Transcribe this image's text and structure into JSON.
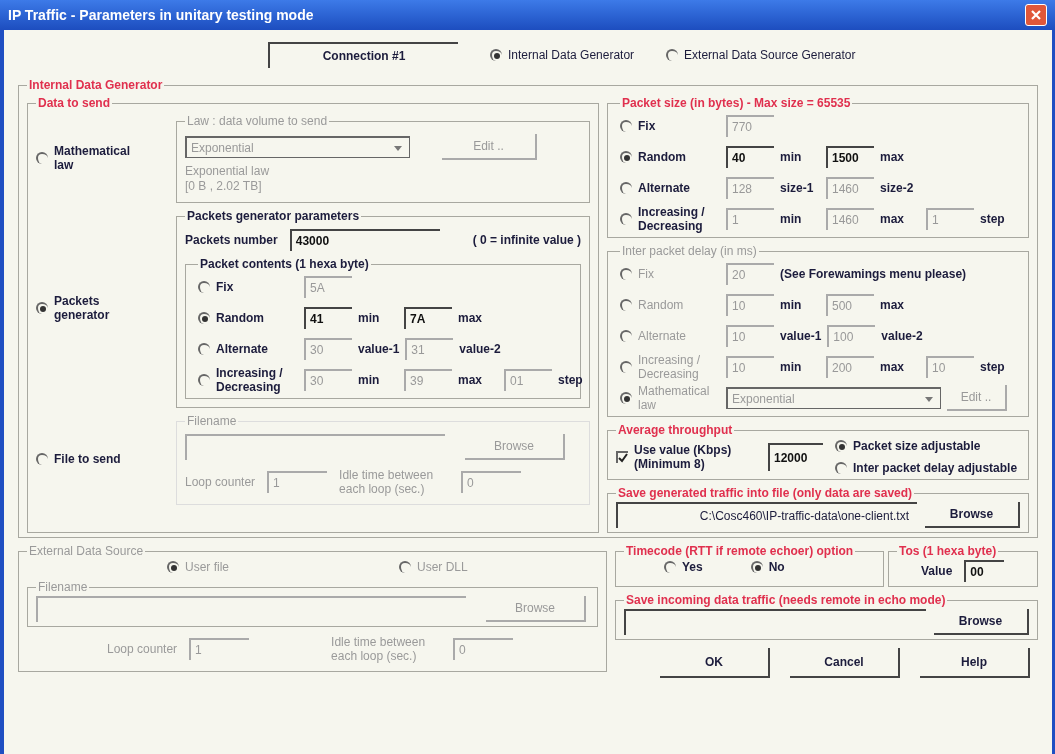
{
  "window": {
    "title": "IP Traffic - Parameters in unitary testing mode"
  },
  "connection": {
    "label": "Connection #1"
  },
  "source_options": [
    {
      "label": "Internal Data Generator",
      "selected": true
    },
    {
      "label": "External Data Source Generator",
      "selected": false
    }
  ],
  "internal": {
    "title": "Internal Data Generator",
    "data_to_send": {
      "title": "Data to send",
      "modes": [
        {
          "label": "Mathematical law",
          "selected": false
        },
        {
          "label": "Packets generator",
          "selected": true
        },
        {
          "label": "File to send",
          "selected": false
        }
      ]
    },
    "law": {
      "title": "Law : data volume to send",
      "disabled": true,
      "dropdown": "Exponential",
      "edit": "Edit ..",
      "description": [
        "Exponential law",
        "[0 B , 2.02 TB]"
      ]
    },
    "packets": {
      "title": "Packets generator parameters",
      "number_label": "Packets number",
      "number": "43000",
      "hint": "( 0 = infinite value )",
      "contents": {
        "title": "Packet contents (1 hexa byte)",
        "disabled": false,
        "rows": [
          {
            "label": "Fix",
            "selected": false,
            "cells": [
              {
                "kind": "field",
                "value": "5A",
                "disabled": true
              }
            ]
          },
          {
            "label": "Random",
            "selected": true,
            "cells": [
              {
                "kind": "field",
                "value": "41",
                "disabled": false
              },
              {
                "kind": "unit",
                "text": "min"
              },
              {
                "kind": "field",
                "value": "7A",
                "disabled": false
              },
              {
                "kind": "unit",
                "text": "max"
              }
            ]
          },
          {
            "label": "Alternate",
            "selected": false,
            "cells": [
              {
                "kind": "field",
                "value": "30",
                "disabled": true
              },
              {
                "kind": "unit",
                "text": "value-1"
              },
              {
                "kind": "field",
                "value": "31",
                "disabled": true
              },
              {
                "kind": "unit",
                "text": "value-2"
              }
            ]
          },
          {
            "label": "Increasing / Decreasing",
            "selected": false,
            "cells": [
              {
                "kind": "field",
                "value": "30",
                "disabled": true
              },
              {
                "kind": "unit",
                "text": "min"
              },
              {
                "kind": "field",
                "value": "39",
                "disabled": true
              },
              {
                "kind": "unit",
                "text": "max"
              },
              {
                "kind": "field",
                "value": "01",
                "disabled": true
              },
              {
                "kind": "unit",
                "text": "step"
              }
            ]
          }
        ]
      }
    },
    "file": {
      "title": "Filename",
      "disabled": true,
      "browse": "Browse",
      "loop_label": "Loop counter",
      "loop": "1",
      "idle_label": "Idle time between each loop (sec.)",
      "idle": "0"
    }
  },
  "packet_size": {
    "title": "Packet size (in bytes) - Max size = 65535",
    "disabled": false,
    "rows": [
      {
        "label": "Fix",
        "selected": false,
        "cells": [
          {
            "kind": "field",
            "value": "770",
            "disabled": true
          }
        ]
      },
      {
        "label": "Random",
        "selected": true,
        "cells": [
          {
            "kind": "field",
            "value": "40",
            "disabled": false
          },
          {
            "kind": "unit",
            "text": "min"
          },
          {
            "kind": "field",
            "value": "1500",
            "disabled": false
          },
          {
            "kind": "unit",
            "text": "max"
          }
        ]
      },
      {
        "label": "Alternate",
        "selected": false,
        "cells": [
          {
            "kind": "field",
            "value": "128",
            "disabled": true
          },
          {
            "kind": "unit",
            "text": "size-1"
          },
          {
            "kind": "field",
            "value": "1460",
            "disabled": true
          },
          {
            "kind": "unit",
            "text": "size-2"
          }
        ]
      },
      {
        "label": "Increasing / Decreasing",
        "selected": false,
        "cells": [
          {
            "kind": "field",
            "value": "1",
            "disabled": true
          },
          {
            "kind": "unit",
            "text": "min"
          },
          {
            "kind": "field",
            "value": "1460",
            "disabled": true
          },
          {
            "kind": "unit",
            "text": "max"
          },
          {
            "kind": "field",
            "value": "1",
            "disabled": true
          },
          {
            "kind": "unit",
            "text": "step"
          }
        ]
      }
    ]
  },
  "delay": {
    "title": "Inter packet delay (in ms)",
    "disabled": true,
    "rows": [
      {
        "label": "Fix",
        "selected": false,
        "cells": [
          {
            "kind": "field",
            "value": "20",
            "disabled": true
          },
          {
            "kind": "unit",
            "text": "(See Forewamings menu please)"
          }
        ]
      },
      {
        "label": "Random",
        "selected": false,
        "cells": [
          {
            "kind": "field",
            "value": "10",
            "disabled": true
          },
          {
            "kind": "unit",
            "text": "min"
          },
          {
            "kind": "field",
            "value": "500",
            "disabled": true
          },
          {
            "kind": "unit",
            "text": "max"
          }
        ]
      },
      {
        "label": "Alternate",
        "selected": false,
        "cells": [
          {
            "kind": "field",
            "value": "10",
            "disabled": true
          },
          {
            "kind": "unit",
            "text": "value-1"
          },
          {
            "kind": "field",
            "value": "100",
            "disabled": true
          },
          {
            "kind": "unit",
            "text": "value-2"
          }
        ]
      },
      {
        "label": "Increasing / Decreasing",
        "selected": false,
        "cells": [
          {
            "kind": "field",
            "value": "10",
            "disabled": true
          },
          {
            "kind": "unit",
            "text": "min"
          },
          {
            "kind": "field",
            "value": "200",
            "disabled": true
          },
          {
            "kind": "unit",
            "text": "max"
          },
          {
            "kind": "field",
            "value": "10",
            "disabled": true
          },
          {
            "kind": "unit",
            "text": "step"
          }
        ]
      },
      {
        "label": "Mathematical law",
        "selected": true,
        "cells": [
          {
            "kind": "dropdown",
            "value": "Exponential",
            "disabled": true
          },
          {
            "kind": "button",
            "text": "Edit ..",
            "disabled": true
          }
        ]
      }
    ]
  },
  "throughput": {
    "title": "Average throughput",
    "checkbox": {
      "label": "Use value (Kbps) (Minimum 8)",
      "checked": true
    },
    "value": "12000",
    "options": [
      {
        "label": "Packet size adjustable",
        "selected": true
      },
      {
        "label": "Inter packet delay adjustable",
        "selected": false
      }
    ]
  },
  "save_generated": {
    "title": "Save generated traffic into file (only data are saved)",
    "path": "C:\\Cosc460\\IP-traffic-data\\one-client.txt",
    "browse": "Browse"
  },
  "external": {
    "title": "External Data Source",
    "disabled": true,
    "options": [
      {
        "label": "User file",
        "selected": true
      },
      {
        "label": "User DLL",
        "selected": false
      }
    ],
    "filename_title": "Filename",
    "browse": "Browse",
    "loop_label": "Loop counter",
    "loop": "1",
    "idle_label": "Idle time between each loop (sec.)",
    "idle": "0"
  },
  "timecode": {
    "title": "Timecode (RTT if remote echoer) option",
    "options": [
      {
        "label": "Yes",
        "selected": false
      },
      {
        "label": "No",
        "selected": true
      }
    ]
  },
  "tos": {
    "title": "Tos (1 hexa byte)",
    "label": "Value",
    "value": "00"
  },
  "save_incoming": {
    "title": "Save incoming data traffic (needs remote in echo mode)",
    "browse": "Browse"
  },
  "buttons": [
    "OK",
    "Cancel",
    "Help"
  ]
}
